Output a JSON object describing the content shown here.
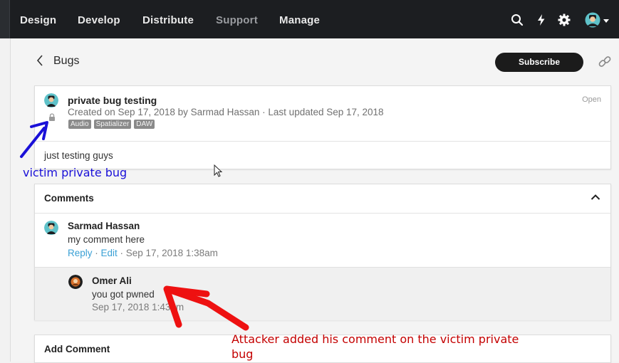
{
  "nav": {
    "items": [
      "Design",
      "Develop",
      "Distribute",
      "Support",
      "Manage"
    ],
    "icons": [
      "search-icon",
      "bolt-icon",
      "gear-icon",
      "user-avatar"
    ]
  },
  "header": {
    "back_label": "Bugs",
    "subscribe_label": "Subscribe"
  },
  "bug": {
    "title": "private bug testing",
    "meta": "Created on Sep 17, 2018 by Sarmad Hassan · Last updated Sep 17, 2018",
    "tags": [
      "Audio",
      "Spatializer",
      "DAW"
    ],
    "status": "Open",
    "body": "just testing guys"
  },
  "comments": {
    "heading": "Comments",
    "items": [
      {
        "author": "Sarmad Hassan",
        "text": "my comment here",
        "reply_label": "Reply",
        "sep1": " · ",
        "edit_label": "Edit",
        "date": " · Sep 17, 2018 1:38am",
        "replies": [
          {
            "author": "Omer Ali",
            "text": "you got pwned",
            "date": "Sep 17, 2018 1:43am"
          }
        ]
      }
    ]
  },
  "add_comment": {
    "heading": "Add Comment"
  },
  "annotations": {
    "blue": "victim private bug",
    "red": "Attacker added his comment on the victim private bug"
  },
  "colors": {
    "topbar": "#1c1e21",
    "link": "#3aa0d5",
    "annotation_blue": "#1a10d8",
    "annotation_red": "#c40000"
  }
}
